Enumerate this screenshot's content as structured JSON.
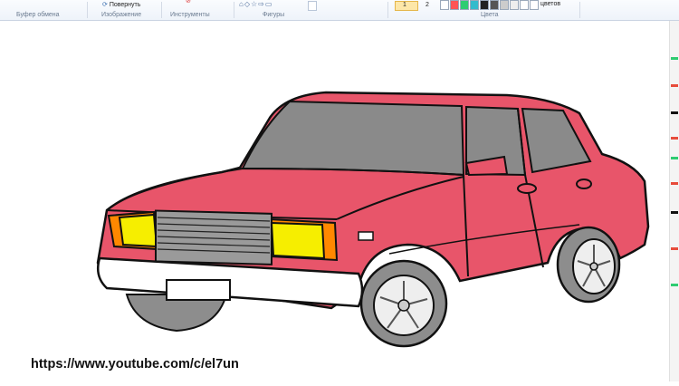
{
  "ribbon": {
    "groups": {
      "clipboard": "Буфер обмена",
      "image": "Изображение",
      "tools": "Инструменты",
      "shapes": "Фигуры",
      "colors": "Цвета"
    },
    "rotate_label": "Повернуть",
    "color1_label": "1",
    "color2_label": "2",
    "edit_colors_label": "цветов",
    "palette": [
      "#ffffff",
      "#ff5555",
      "#2ecc71",
      "#33bbcc",
      "#222222",
      "#555555",
      "#cccccc",
      "#eeeeee",
      "#ffffff",
      "#ffffff"
    ]
  },
  "colors": {
    "body": "#e8556a",
    "glass": "#8a8a8a",
    "light": "#f6ee00",
    "outline": "#111111",
    "bumper": "#ffffff",
    "tire": "#8d8d8d"
  },
  "watermark": "https://www.youtube.com/c/el7un"
}
